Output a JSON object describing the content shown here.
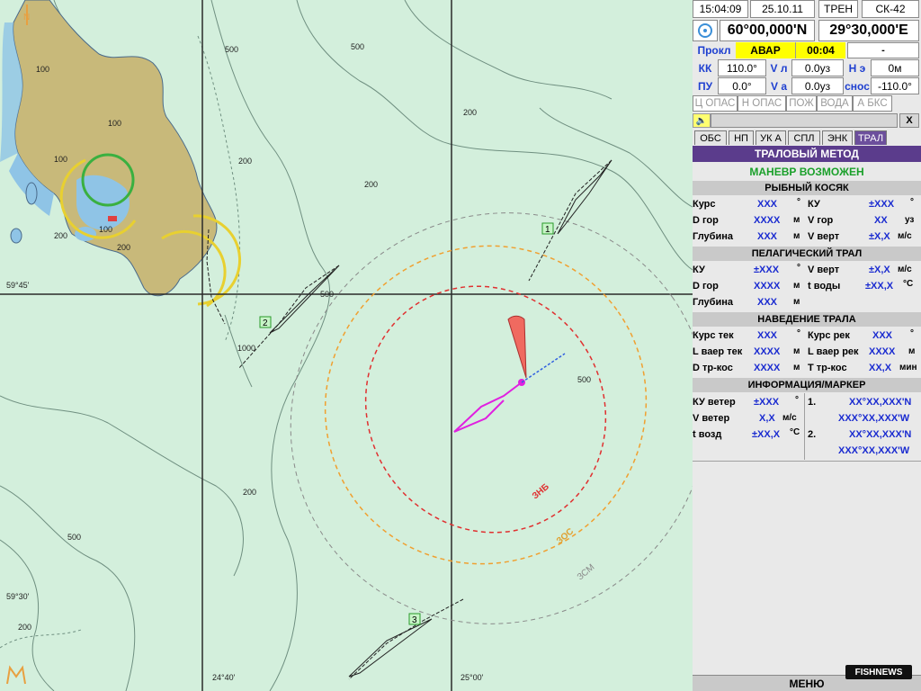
{
  "header": {
    "time": "15:04:09",
    "date": "25.10.11",
    "mode": "ТРЕН",
    "datum": "СК-42",
    "latitude": "60°00,000'N",
    "longitude": "29°30,000'E"
  },
  "status": {
    "prokl_label": "Прокл",
    "alarm": "АВАР",
    "timer": "00:04",
    "dash": "-"
  },
  "motion": {
    "kk_label": "КК",
    "kk_value": "110.0°",
    "pu_label": "ПУ",
    "pu_value": "0.0°",
    "vl_label": "V л",
    "vl_value": "0.0уз",
    "va_label": "V a",
    "va_value": "0.0уз",
    "he_label": "H э",
    "he_value": "0м",
    "snos_label": "снос",
    "snos_value": "-110.0°"
  },
  "danger_items": [
    "Ц ОПАС",
    "Н ОПАС",
    "ПОЖ",
    "ВОДА",
    "А БКС"
  ],
  "close_label": "X",
  "tabs": [
    "ОБС",
    "НП",
    "УК А",
    "СПЛ",
    "ЭНК",
    "ТРАЛ"
  ],
  "trawl": {
    "title": "ТРАЛОВЫЙ МЕТОД",
    "maneuver": "МАНЕВР ВОЗМОЖЕН",
    "fish_school": {
      "title": "РЫБНЫЙ КОСЯК",
      "rows": [
        {
          "k1": "Курс",
          "v1": "XXX",
          "u1": "°",
          "k2": "КУ",
          "v2": "±XXX",
          "u2": "°"
        },
        {
          "k1": "D гор",
          "v1": "XXXX",
          "u1": "м",
          "k2": "V гор",
          "v2": "XX",
          "u2": "уз"
        },
        {
          "k1": "Глубина",
          "v1": "XXX",
          "u1": "м",
          "k2": "V верт",
          "v2": "±X,X",
          "u2": "м/с"
        }
      ]
    },
    "pelagic": {
      "title": "ПЕЛАГИЧЕСКИЙ ТРАЛ",
      "rows": [
        {
          "k1": "КУ",
          "v1": "±XXX",
          "u1": "°",
          "k2": "V верт",
          "v2": "±X,X",
          "u2": "м/с"
        },
        {
          "k1": "D гор",
          "v1": "XXXX",
          "u1": "м",
          "k2": "t воды",
          "v2": "±XX,X",
          "u2": "°C"
        },
        {
          "k1": "Глубина",
          "v1": "XXX",
          "u1": "м",
          "k2": "",
          "v2": "",
          "u2": ""
        }
      ]
    },
    "guidance": {
      "title": "НАВЕДЕНИЕ ТРАЛА",
      "rows": [
        {
          "k1": "Курс тек",
          "v1": "XXX",
          "u1": "°",
          "k2": "Курс рек",
          "v2": "XXX",
          "u2": "°"
        },
        {
          "k1": "L ваер тек",
          "v1": "XXXX",
          "u1": "м",
          "k2": "L ваер рек",
          "v2": "XXXX",
          "u2": "м"
        },
        {
          "k1": "D тр-кос",
          "v1": "XXXX",
          "u1": "м",
          "k2": "T тр-кос",
          "v2": "XX,X",
          "u2": "мин"
        }
      ]
    },
    "info": {
      "title": "ИНФОРМАЦИЯ/МАРКЕР",
      "rows": [
        {
          "k1": "КУ ветер",
          "v1": "±XXX",
          "u1": "°",
          "n": "1.",
          "p": "XX°XX,XXX'N"
        },
        {
          "k1": "V ветер",
          "v1": "X,X",
          "u1": "м/с",
          "n": "",
          "p": "XXX°XX,XXX'W"
        },
        {
          "k1": "t возд",
          "v1": "±XX,X",
          "u1": "°C",
          "n": "2.",
          "p": "XX°XX,XXX'N"
        },
        {
          "k1": "",
          "v1": "",
          "u1": "",
          "n": "",
          "p": "XXX°XX,XXX'W"
        }
      ]
    }
  },
  "menu_label": "МЕНЮ",
  "watermark": "FISHNEWS",
  "map": {
    "coord_labels": [
      "59°45'",
      "59°30'",
      "24°40'",
      "25°00'"
    ],
    "depth_labels": [
      "500",
      "500",
      "200",
      "200",
      "200",
      "500",
      "1000",
      "500",
      "500",
      "200",
      "200",
      "100",
      "100",
      "100",
      "100",
      "200",
      "200"
    ],
    "zone_labels": [
      "ЗНБ",
      "ЗОС",
      "ЗСМ"
    ],
    "marker_labels": [
      "1",
      "2",
      "3"
    ],
    "north_label": "N"
  },
  "colors": {
    "land": "#c8b97a",
    "shallow": "#8fc4e6",
    "sea": "#d3efdc",
    "zone_red": "#e03030",
    "zone_orange": "#f0a030",
    "zone_gray": "#8a8a8a",
    "track_magenta": "#e020e0",
    "sector_red": "#f06a60",
    "header_purple": "#5b3c8c",
    "maneuver_green": "#1aa02a",
    "alarm_yellow": "#ffff00",
    "label_blue": "#1e3fd0"
  }
}
